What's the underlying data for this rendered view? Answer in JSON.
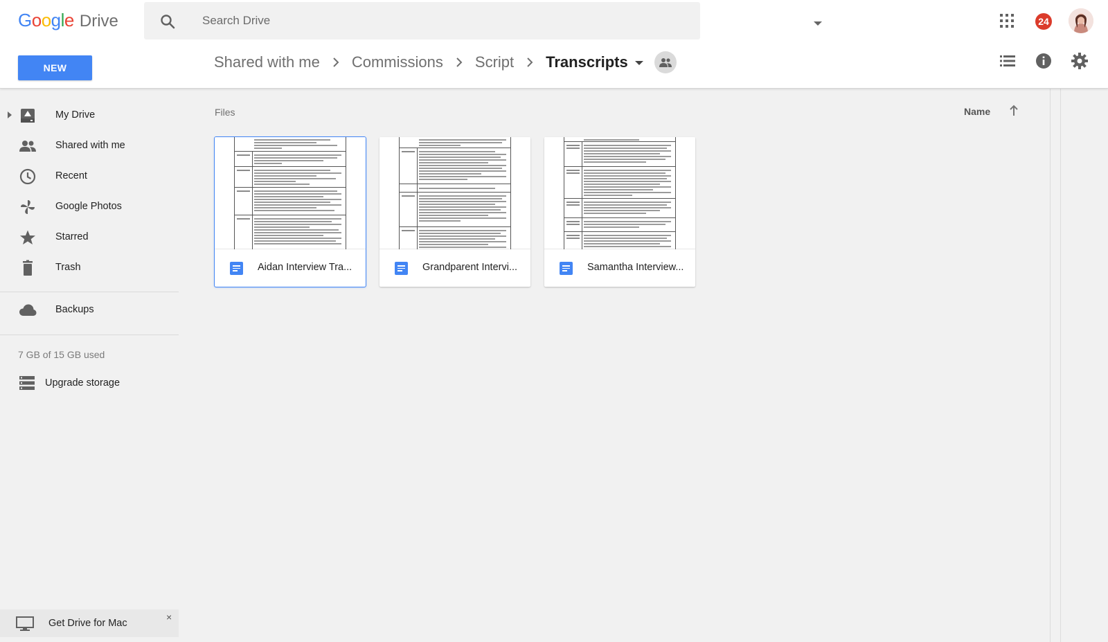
{
  "app": {
    "logo_google": "Google",
    "logo_drive": "Drive"
  },
  "search": {
    "placeholder": "Search Drive"
  },
  "header": {
    "notification_count": "24"
  },
  "new_button": {
    "label": "NEW"
  },
  "breadcrumb": {
    "items": [
      "Shared with me",
      "Commissions",
      "Script",
      "Transcripts"
    ]
  },
  "sidebar": {
    "items": [
      {
        "label": "My Drive",
        "icon": "my-drive-icon"
      },
      {
        "label": "Shared with me",
        "icon": "shared-people-icon"
      },
      {
        "label": "Recent",
        "icon": "clock-icon"
      },
      {
        "label": "Google Photos",
        "icon": "pinwheel-icon"
      },
      {
        "label": "Starred",
        "icon": "star-icon"
      },
      {
        "label": "Trash",
        "icon": "trash-icon"
      },
      {
        "label": "Backups",
        "icon": "cloud-icon"
      }
    ],
    "storage_text": "7 GB of 15 GB used",
    "upgrade_label": "Upgrade storage",
    "get_drive_label": "Get Drive for Mac",
    "close_glyph": "×"
  },
  "main": {
    "section_label": "Files",
    "sort_label": "Name",
    "files": [
      {
        "name": "Aidan Interview Tra...",
        "selected": true
      },
      {
        "name": "Grandparent Intervi...",
        "selected": false
      },
      {
        "name": "Samantha Interview...",
        "selected": false
      }
    ]
  },
  "colors": {
    "accent": "#4285f4",
    "badge": "#db3b2b",
    "google_blue": "#4285f4",
    "google_red": "#ea4335",
    "google_yellow": "#fbbc05",
    "google_green": "#34a853"
  }
}
